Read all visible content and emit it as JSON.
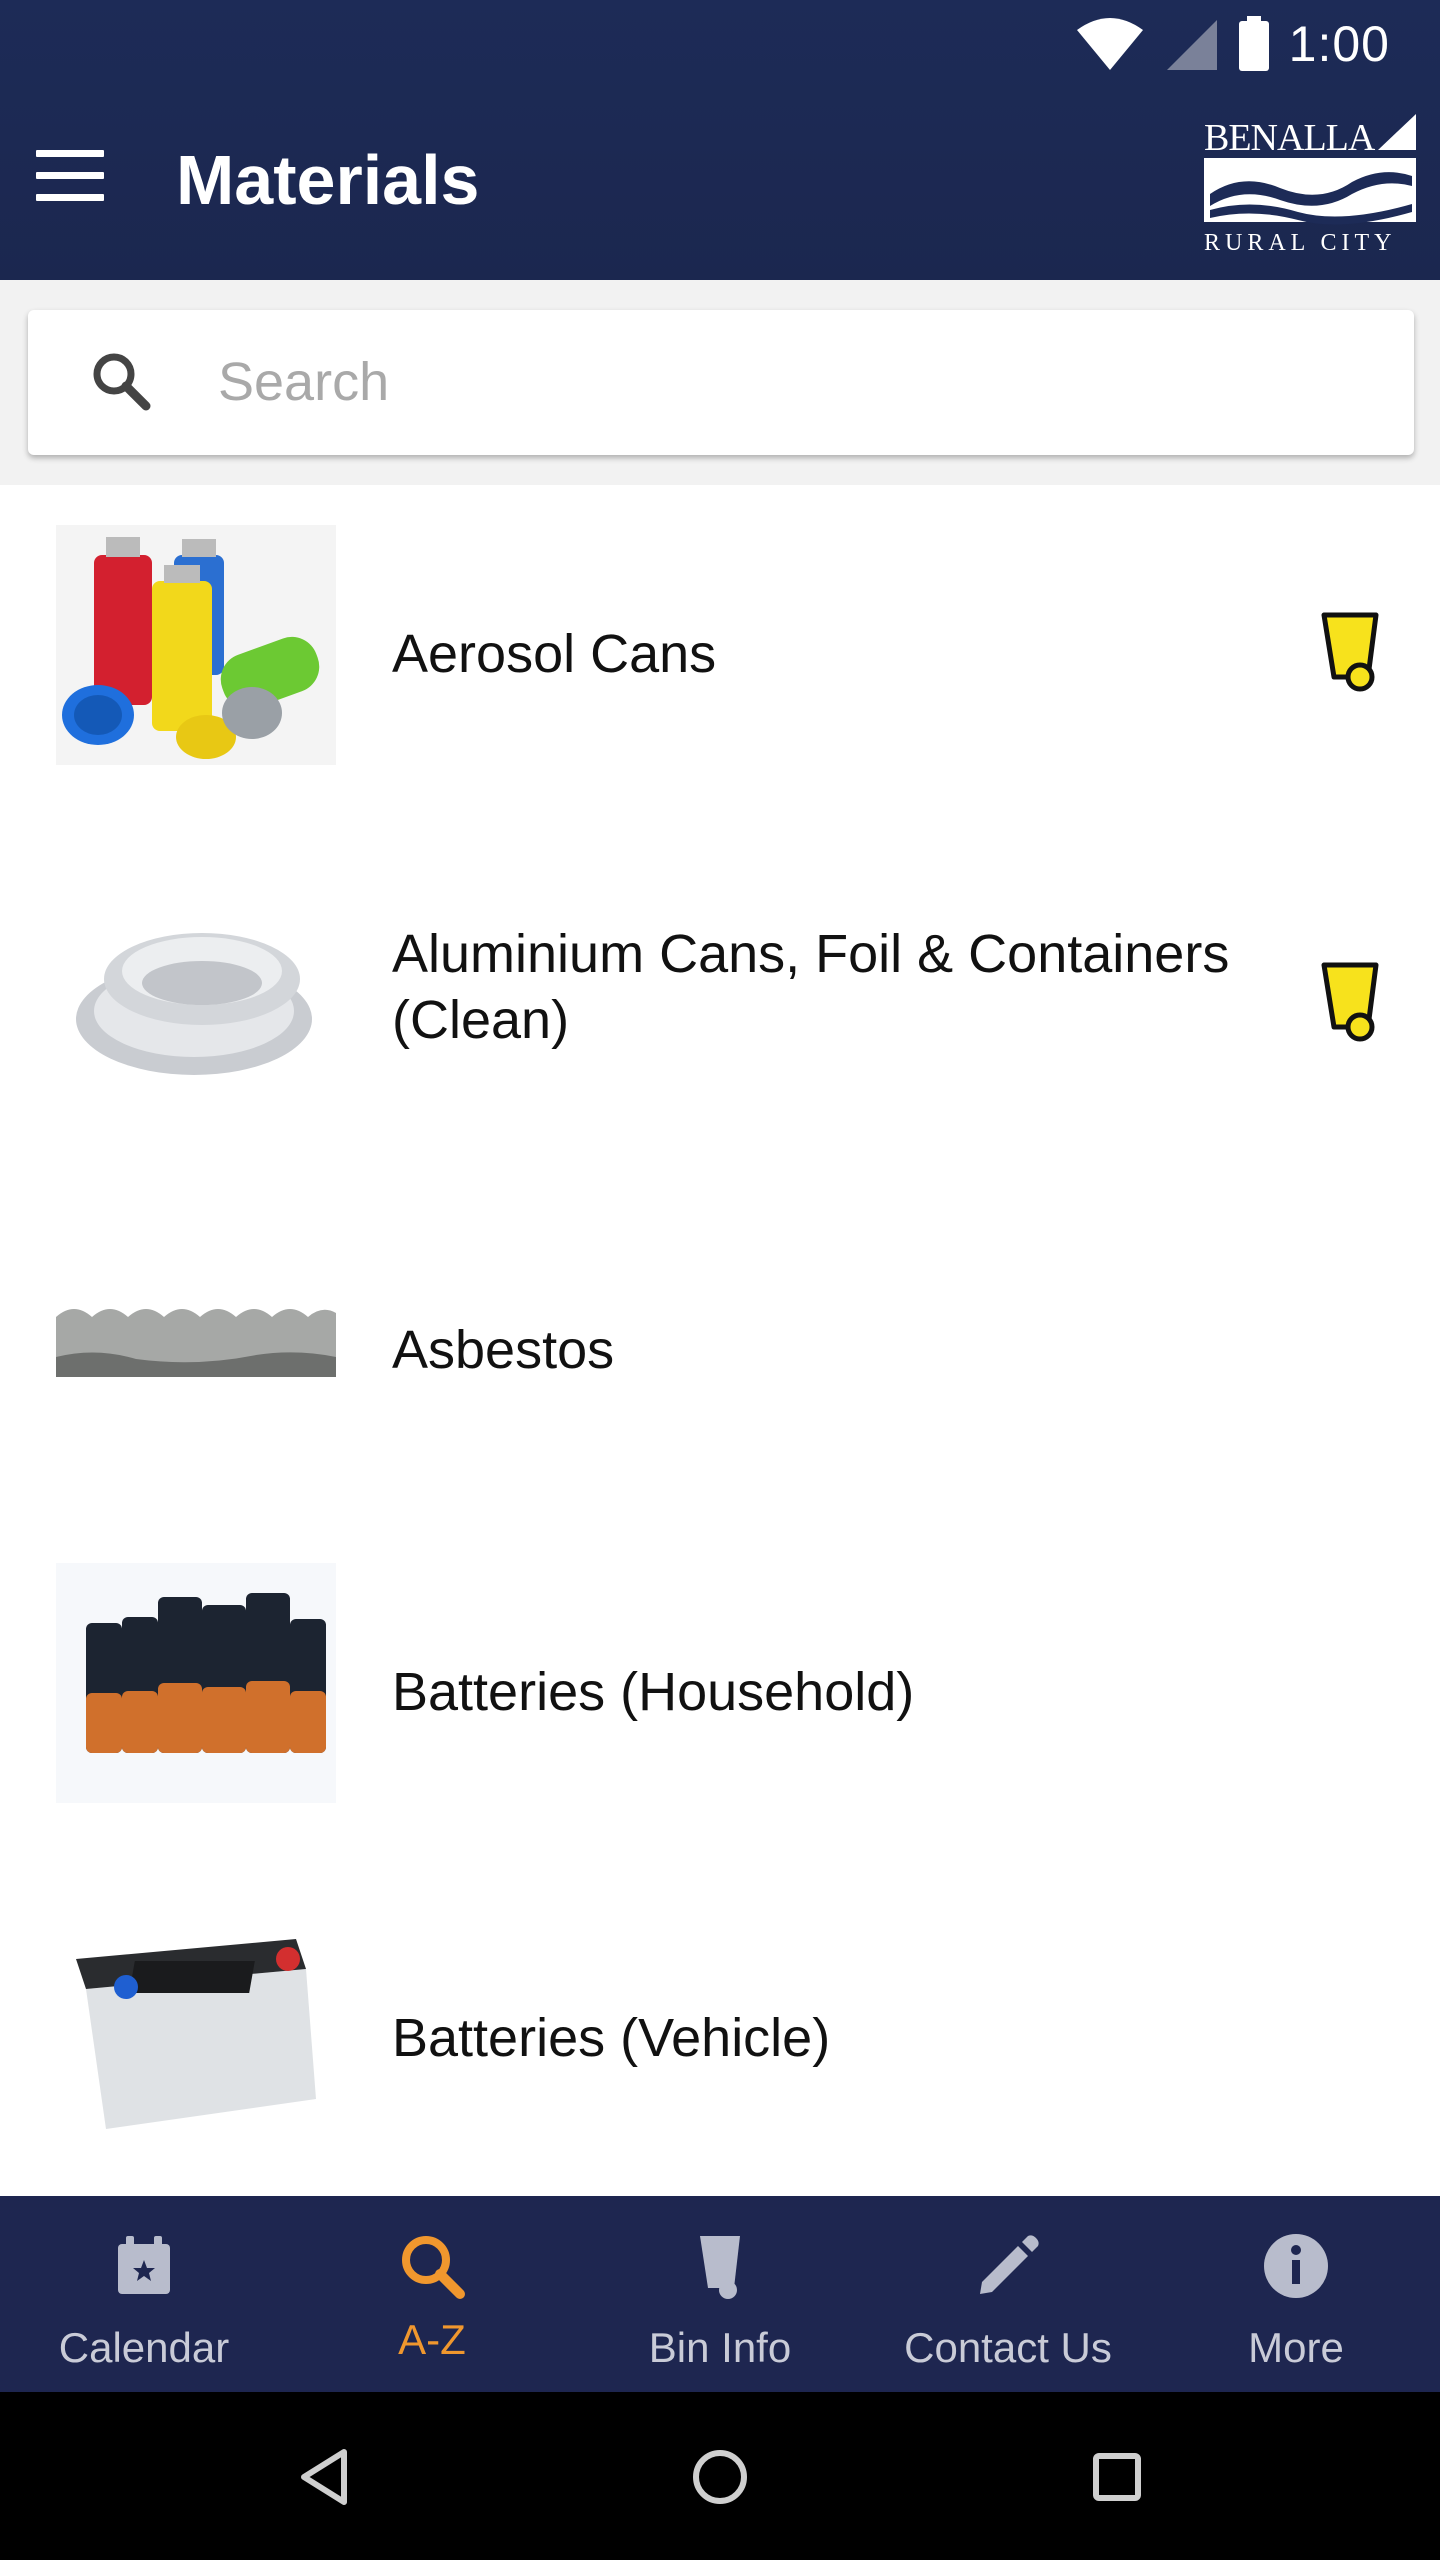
{
  "status_bar": {
    "time": "1:00"
  },
  "app_bar": {
    "title": "Materials",
    "logo": {
      "line1": "BENALLA",
      "line2": "RURAL CITY"
    }
  },
  "search": {
    "placeholder": "Search",
    "value": ""
  },
  "materials": [
    {
      "label": "Aerosol Cans",
      "bin": "yellow"
    },
    {
      "label": "Aluminium Cans, Foil & Containers (Clean)",
      "bin": "yellow"
    },
    {
      "label": "Asbestos",
      "bin": null
    },
    {
      "label": "Batteries (Household)",
      "bin": null
    },
    {
      "label": "Batteries (Vehicle)",
      "bin": null
    }
  ],
  "bottom_nav": [
    {
      "label": "Calendar",
      "icon": "calendar-icon",
      "active": false
    },
    {
      "label": "A-Z",
      "icon": "search-icon",
      "active": true
    },
    {
      "label": "Bin Info",
      "icon": "bin-icon",
      "active": false
    },
    {
      "label": "Contact Us",
      "icon": "pencil-icon",
      "active": false
    },
    {
      "label": "More",
      "icon": "info-icon",
      "active": false
    }
  ],
  "colors": {
    "header": "#1d2b57",
    "nav_bg": "#1e2650",
    "nav_active": "#f0972e",
    "bin_yellow": "#f7e21c"
  }
}
